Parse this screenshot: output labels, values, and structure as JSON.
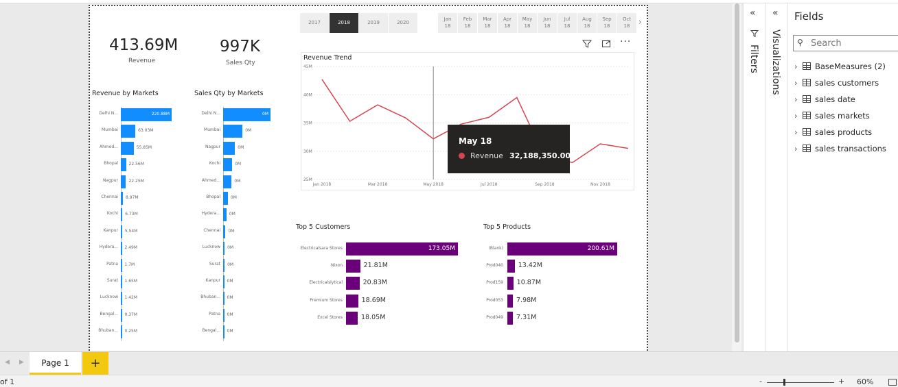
{
  "cards": [
    {
      "value": "413.69M",
      "label": "Revenue"
    },
    {
      "value": "997K",
      "label": "Sales Qty"
    }
  ],
  "years": [
    "2017",
    "2018",
    "2019",
    "2020"
  ],
  "selected_year": "2018",
  "months": [
    {
      "m": "Jan",
      "y": "18"
    },
    {
      "m": "Feb",
      "y": "18"
    },
    {
      "m": "Mar",
      "y": "18"
    },
    {
      "m": "Apr",
      "y": "18"
    },
    {
      "m": "May",
      "y": "18"
    },
    {
      "m": "Jun",
      "y": "18"
    },
    {
      "m": "Jul",
      "y": "18"
    },
    {
      "m": "Aug",
      "y": "18"
    },
    {
      "m": "Sep",
      "y": "18"
    },
    {
      "m": "Oct",
      "y": "18"
    }
  ],
  "revenue_by_markets": {
    "title": "Revenue by Markets",
    "rows": [
      {
        "label": "Delhi N...",
        "value": 220.88,
        "text": "220.88M"
      },
      {
        "label": "Mumbai",
        "value": 63.03,
        "text": "63.03M"
      },
      {
        "label": "Ahmed...",
        "value": 55.85,
        "text": "55.85M"
      },
      {
        "label": "Bhopal",
        "value": 22.56,
        "text": "22.56M"
      },
      {
        "label": "Nagpur",
        "value": 22.25,
        "text": "22.25M"
      },
      {
        "label": "Chennai",
        "value": 8.97,
        "text": "8.97M"
      },
      {
        "label": "Kochi",
        "value": 6.73,
        "text": "6.73M"
      },
      {
        "label": "Kanpur",
        "value": 5.54,
        "text": "5.54M"
      },
      {
        "label": "Hydera...",
        "value": 2.49,
        "text": "2.49M"
      },
      {
        "label": "Patna",
        "value": 1.7,
        "text": "1.7M"
      },
      {
        "label": "Surat",
        "value": 1.65,
        "text": "1.65M"
      },
      {
        "label": "Lucknow",
        "value": 1.42,
        "text": "1.42M"
      },
      {
        "label": "Bengal...",
        "value": 0.37,
        "text": "0.37M"
      },
      {
        "label": "Bhuban...",
        "value": 0.25,
        "text": "0.25M"
      }
    ]
  },
  "qty_by_markets": {
    "title": "Sales Qty by Markets",
    "rows": [
      {
        "label": "Delhi N...",
        "value": 100,
        "text": "0M"
      },
      {
        "label": "Mumbai",
        "value": 41,
        "text": "0M"
      },
      {
        "label": "Nagpur",
        "value": 25,
        "text": "0M"
      },
      {
        "label": "Kochi",
        "value": 19,
        "text": "0M"
      },
      {
        "label": "Ahmed...",
        "value": 18,
        "text": "0M"
      },
      {
        "label": "Bhopal",
        "value": 10,
        "text": "0M"
      },
      {
        "label": "Hydera...",
        "value": 7,
        "text": "0M"
      },
      {
        "label": "Chennai",
        "value": 5,
        "text": "0M"
      },
      {
        "label": "Lucknow",
        "value": 3,
        "text": "0M"
      },
      {
        "label": "Surat",
        "value": 3,
        "text": "0M"
      },
      {
        "label": "Kanpur",
        "value": 2,
        "text": "0M"
      },
      {
        "label": "Bhuban...",
        "value": 2,
        "text": "0M"
      },
      {
        "label": "Patna",
        "value": 2,
        "text": "0M"
      },
      {
        "label": "Bengal...",
        "value": 1,
        "text": "0M"
      }
    ]
  },
  "chart_data": [
    {
      "type": "line",
      "title": "Revenue Trend",
      "x": [
        "Jan 2018",
        "Feb 2018",
        "Mar 2018",
        "Apr 2018",
        "May 2018",
        "Jun 2018",
        "Jul 2018",
        "Aug 2018",
        "Sep 2018",
        "Oct 2018",
        "Nov 2018",
        "Dec 2018"
      ],
      "x_tick_labels": [
        "Jan 2018",
        "Mar 2018",
        "May 2018",
        "Jul 2018",
        "Sep 2018",
        "Nov 2018"
      ],
      "series": [
        {
          "name": "Revenue",
          "values": [
            42.7,
            35.3,
            38.2,
            35.9,
            32.19,
            34.8,
            36.0,
            39.5,
            29.0,
            28.0,
            31.3,
            30.5
          ]
        }
      ],
      "y_tick_labels": [
        "45M",
        "40M",
        "35M",
        "30M",
        "25M"
      ],
      "ylim": [
        25,
        45
      ],
      "color": "#d64550",
      "grid": true
    },
    {
      "type": "bar",
      "title": "Top 5 Customers",
      "categories": [
        "Electricalsara Stores",
        "Nixon",
        "Electricalslytical",
        "Premium Stores",
        "Excel Stores"
      ],
      "values": [
        173.05,
        21.81,
        20.83,
        18.69,
        18.05
      ],
      "labels": [
        "173.05M",
        "21.81M",
        "20.83M",
        "18.69M",
        "18.05M"
      ]
    },
    {
      "type": "bar",
      "title": "Top 5 Products",
      "categories": [
        "(Blank)",
        "Prod040",
        "Prod159",
        "Prod053",
        "Prod049"
      ],
      "values": [
        200.61,
        13.42,
        10.87,
        7.98,
        7.31
      ],
      "labels": [
        "200.61M",
        "13.42M",
        "10.87M",
        "7.98M",
        "7.31M"
      ]
    }
  ],
  "tooltip": {
    "title": "May 18",
    "series": "Revenue",
    "value": "32,188,350.00",
    "dot_color": "#d64550"
  },
  "panes": {
    "filters": "Filters",
    "visualizations": "Visualizations",
    "fields_title": "Fields"
  },
  "search": {
    "placeholder": "Search"
  },
  "fields": [
    "BaseMeasures (2)",
    "sales customers",
    "sales date",
    "sales markets",
    "sales products",
    "sales transactions"
  ],
  "tabs": {
    "page": "Page 1",
    "add": "+"
  },
  "status": {
    "page_of": "of 1",
    "zoom": "60%",
    "minus": "-",
    "plus": "+"
  },
  "colors": {
    "bar_blue": "#118dff",
    "bar_purple": "#6b007b",
    "line_red": "#d64550",
    "tab_yellow": "#f2c811"
  }
}
